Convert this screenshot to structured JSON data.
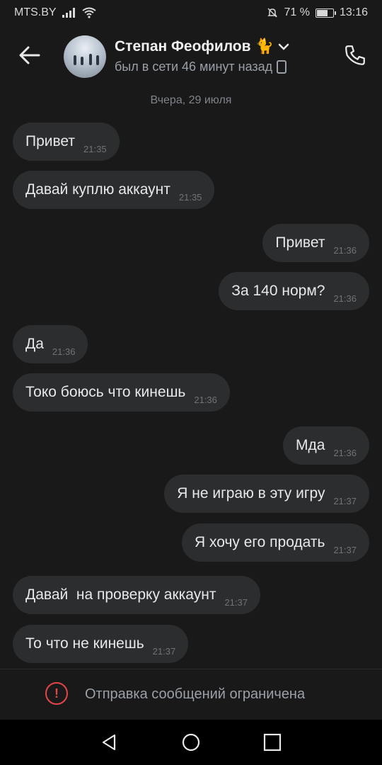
{
  "status_bar": {
    "carrier": "MTS.BY",
    "battery_text": "71 %",
    "battery_level": 0.71,
    "time": "13:16"
  },
  "header": {
    "contact_name": "Степан Феофилов",
    "name_emoji": "🐈",
    "last_seen": "был в сети 46 минут назад"
  },
  "chat": {
    "date_separator": "Вчера, 29 июля",
    "messages": [
      {
        "text": "Привет",
        "time": "21:35",
        "side": "in"
      },
      {
        "text": "Давай куплю аккаунт",
        "time": "21:35",
        "side": "in"
      },
      {
        "text": "Привет",
        "time": "21:36",
        "side": "out"
      },
      {
        "text": "За 140 норм?",
        "time": "21:36",
        "side": "out"
      },
      {
        "text": "Да",
        "time": "21:36",
        "side": "in"
      },
      {
        "text": "Токо боюсь что кинешь",
        "time": "21:36",
        "side": "in"
      },
      {
        "text": "Мда",
        "time": "21:36",
        "side": "out"
      },
      {
        "text": "Я не играю в эту игру",
        "time": "21:37",
        "side": "out"
      },
      {
        "text": "Я хочу его продать",
        "time": "21:37",
        "side": "out"
      },
      {
        "text": "Давай  на проверку аккаунт",
        "time": "21:37",
        "side": "in"
      },
      {
        "text": "То что не кинешь",
        "time": "21:37",
        "side": "in"
      }
    ]
  },
  "bottom": {
    "restricted_text": "Отправка сообщений ограничена",
    "warning_symbol": "!",
    "warning_color": "#e64646"
  }
}
